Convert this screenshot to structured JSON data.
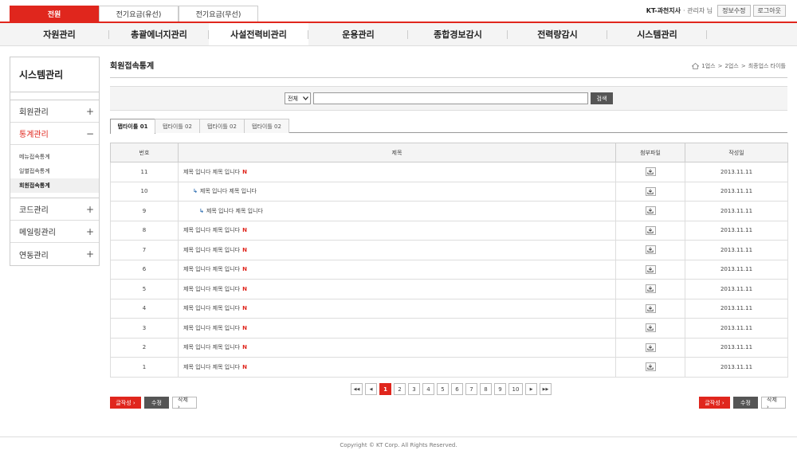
{
  "top_tabs": [
    "전원",
    "전기요금(유선)",
    "전기요금(무선)"
  ],
  "user": {
    "name": "KT-과천지사",
    "role": "· 관리자 님",
    "info_button": "정보수정",
    "logout_button": "로그아웃"
  },
  "nav": [
    "자원관리",
    "총괄에너지관리",
    "사설전력비관리",
    "운용관리",
    "종합경보감시",
    "전력량감시",
    "시스템관리"
  ],
  "sidebar": {
    "title": "시스템관리",
    "items": [
      {
        "label": "회원관리",
        "sign": "+"
      },
      {
        "label": "통계관리",
        "sign": "−"
      }
    ],
    "sub_items": [
      "메뉴접속통계",
      "일별접속통계",
      "회원접속통계"
    ],
    "items_after": [
      {
        "label": "코드관리",
        "sign": "+"
      },
      {
        "label": "메일링관리",
        "sign": "+"
      },
      {
        "label": "연동관리",
        "sign": "+"
      }
    ]
  },
  "page": {
    "title": "회원접속통계",
    "breadcrumb": [
      "1업스",
      ">",
      "2업스",
      ">",
      "최종업스 타이틀"
    ]
  },
  "search": {
    "select_value": "전체",
    "button": "검색"
  },
  "tabs": [
    "탭타이틀 01",
    "탭타이틀 02",
    "탭타이틀 02",
    "탭타이틀 02"
  ],
  "table": {
    "headers": [
      "번호",
      "제목",
      "첨부파일",
      "작성일"
    ],
    "rows": [
      {
        "no": "11",
        "title": "제목 입니다 제목 입니다",
        "new": "N",
        "date": "2013.11.11"
      },
      {
        "no": "10",
        "title": "제목 입니다 제목 입니다",
        "new": "",
        "date": "2013.11.11"
      },
      {
        "no": "9",
        "title": "제목 입니다 제목 입니다",
        "new": "",
        "date": "2013.11.11"
      },
      {
        "no": "8",
        "title": "제목 입니다 제목 입니다",
        "new": "N",
        "date": "2013.11.11"
      },
      {
        "no": "7",
        "title": "제목 입니다 제목 입니다",
        "new": "N",
        "date": "2013.11.11"
      },
      {
        "no": "6",
        "title": "제목 입니다 제목 입니다",
        "new": "N",
        "date": "2013.11.11"
      },
      {
        "no": "5",
        "title": "제목 입니다 제목 입니다",
        "new": "N",
        "date": "2013.11.11"
      },
      {
        "no": "4",
        "title": "제목 입니다 제목 입니다",
        "new": "N",
        "date": "2013.11.11"
      },
      {
        "no": "3",
        "title": "제목 입니다 제목 입니다",
        "new": "N",
        "date": "2013.11.11"
      },
      {
        "no": "2",
        "title": "제목 입니다 제목 입니다",
        "new": "N",
        "date": "2013.11.11"
      },
      {
        "no": "1",
        "title": "제목 입니다 제목 입니다",
        "new": "N",
        "date": "2013.11.11"
      }
    ]
  },
  "pager": {
    "first": "◀◀",
    "prev": "◀",
    "pages": [
      "1",
      "2",
      "3",
      "4",
      "5",
      "6",
      "7",
      "8",
      "9",
      "10"
    ],
    "next": "▶",
    "last": "▶▶"
  },
  "actions": {
    "write": "글작성 ›",
    "edit": "수정",
    "delete": "삭제 ›"
  },
  "footer": "Copyright © KT Corp. All Rights Reserved.",
  "colors": {
    "accent": "#e0261d",
    "dark_button": "#555555"
  }
}
